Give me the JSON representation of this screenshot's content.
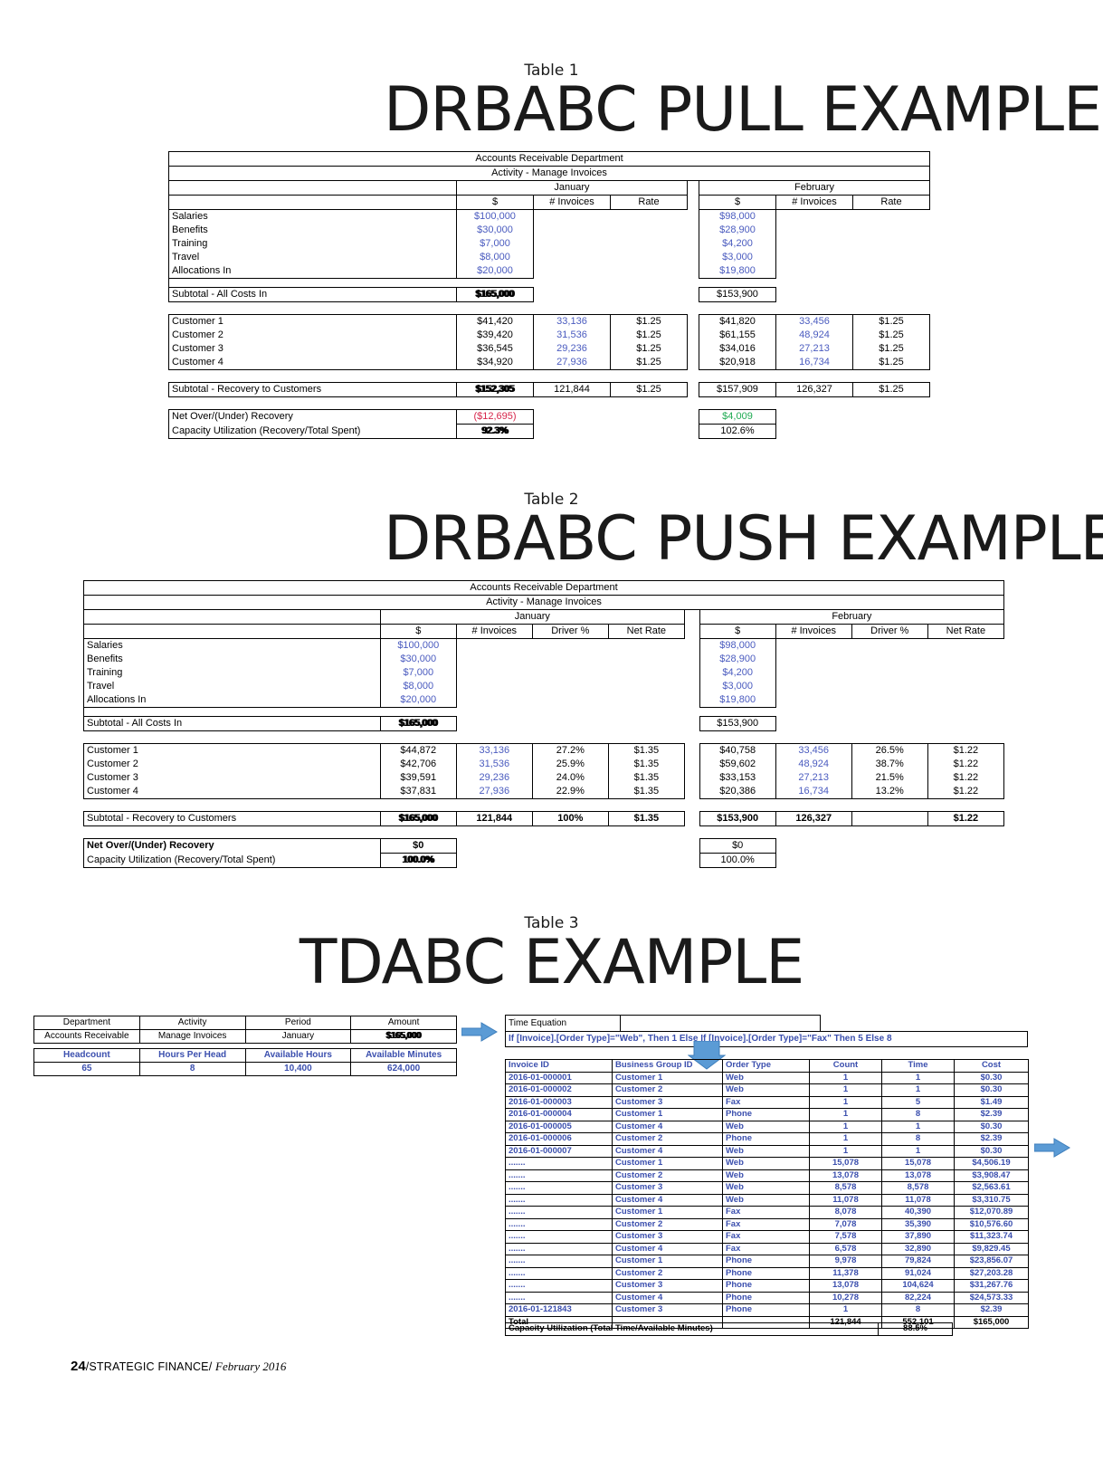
{
  "page": {
    "footer_page": "24",
    "footer_pub": "/STRATEGIC FINANCE/",
    "footer_issue": "February 2016"
  },
  "table1": {
    "caption": "Table 1",
    "title": "DRBABC PULL EXAMPLE",
    "dept": "Accounts Receivable Department",
    "activity": "Activity - Manage Invoices",
    "period_jan": "January",
    "period_feb": "February",
    "colheads": [
      "$",
      "# Invoices",
      "Rate"
    ],
    "cost_rows": [
      {
        "label": "Salaries",
        "jan_dollar": "$100,000",
        "feb_dollar": "$98,000"
      },
      {
        "label": "Benefits",
        "jan_dollar": "$30,000",
        "feb_dollar": "$28,900"
      },
      {
        "label": "Training",
        "jan_dollar": "$7,000",
        "feb_dollar": "$4,200"
      },
      {
        "label": "Travel",
        "jan_dollar": "$8,000",
        "feb_dollar": "$3,000"
      },
      {
        "label": "Allocations In",
        "jan_dollar": "$20,000",
        "feb_dollar": "$19,800"
      }
    ],
    "subtotal_costs": {
      "label": "Subtotal - All Costs In",
      "jan": "$165,000",
      "feb": "$153,900"
    },
    "customer_rows": [
      {
        "label": "Customer 1",
        "jan_dollar": "$41,420",
        "jan_inv": "33,136",
        "jan_rate": "$1.25",
        "feb_dollar": "$41,820",
        "feb_inv": "33,456",
        "feb_rate": "$1.25"
      },
      {
        "label": "Customer 2",
        "jan_dollar": "$39,420",
        "jan_inv": "31,536",
        "jan_rate": "$1.25",
        "feb_dollar": "$61,155",
        "feb_inv": "48,924",
        "feb_rate": "$1.25"
      },
      {
        "label": "Customer 3",
        "jan_dollar": "$36,545",
        "jan_inv": "29,236",
        "jan_rate": "$1.25",
        "feb_dollar": "$34,016",
        "feb_inv": "27,213",
        "feb_rate": "$1.25"
      },
      {
        "label": "Customer 4",
        "jan_dollar": "$34,920",
        "jan_inv": "27,936",
        "jan_rate": "$1.25",
        "feb_dollar": "$20,918",
        "feb_inv": "16,734",
        "feb_rate": "$1.25"
      }
    ],
    "subtotal_recovery": {
      "label": "Subtotal - Recovery to Customers",
      "jan_dollar": "$152,305",
      "jan_inv": "121,844",
      "jan_rate": "$1.25",
      "feb_dollar": "$157,909",
      "feb_inv": "126,327",
      "feb_rate": "$1.25"
    },
    "net_recovery": {
      "label": "Net Over/(Under) Recovery",
      "jan": "($12,695)",
      "feb": "$4,009"
    },
    "capacity": {
      "label": "Capacity Utilization (Recovery/Total Spent)",
      "jan": "92.3%",
      "feb": "102.6%"
    }
  },
  "table2": {
    "caption": "Table 2",
    "title": "DRBABC PUSH EXAMPLE",
    "dept": "Accounts Receivable Department",
    "activity": "Activity - Manage Invoices",
    "period_jan": "January",
    "period_feb": "February",
    "colheads": [
      "$",
      "# Invoices",
      "Driver %",
      "Net Rate"
    ],
    "cost_rows": [
      {
        "label": "Salaries",
        "jan_dollar": "$100,000",
        "feb_dollar": "$98,000"
      },
      {
        "label": "Benefits",
        "jan_dollar": "$30,000",
        "feb_dollar": "$28,900"
      },
      {
        "label": "Training",
        "jan_dollar": "$7,000",
        "feb_dollar": "$4,200"
      },
      {
        "label": "Travel",
        "jan_dollar": "$8,000",
        "feb_dollar": "$3,000"
      },
      {
        "label": "Allocations In",
        "jan_dollar": "$20,000",
        "feb_dollar": "$19,800"
      }
    ],
    "subtotal_costs": {
      "label": "Subtotal - All Costs In",
      "jan": "$165,000",
      "feb": "$153,900"
    },
    "customer_rows": [
      {
        "label": "Customer 1",
        "jan_dollar": "$44,872",
        "jan_inv": "33,136",
        "jan_driver": "27.2%",
        "jan_rate": "$1.35",
        "feb_dollar": "$40,758",
        "feb_inv": "33,456",
        "feb_driver": "26.5%",
        "feb_rate": "$1.22"
      },
      {
        "label": "Customer 2",
        "jan_dollar": "$42,706",
        "jan_inv": "31,536",
        "jan_driver": "25.9%",
        "jan_rate": "$1.35",
        "feb_dollar": "$59,602",
        "feb_inv": "48,924",
        "feb_driver": "38.7%",
        "feb_rate": "$1.22"
      },
      {
        "label": "Customer 3",
        "jan_dollar": "$39,591",
        "jan_inv": "29,236",
        "jan_driver": "24.0%",
        "jan_rate": "$1.35",
        "feb_dollar": "$33,153",
        "feb_inv": "27,213",
        "feb_driver": "21.5%",
        "feb_rate": "$1.22"
      },
      {
        "label": "Customer 4",
        "jan_dollar": "$37,831",
        "jan_inv": "27,936",
        "jan_driver": "22.9%",
        "jan_rate": "$1.35",
        "feb_dollar": "$20,386",
        "feb_inv": "16,734",
        "feb_driver": "13.2%",
        "feb_rate": "$1.22"
      }
    ],
    "subtotal_recovery": {
      "label": "Subtotal - Recovery to Customers",
      "jan_dollar": "$165,000",
      "jan_inv": "121,844",
      "jan_driver": "100%",
      "jan_rate": "$1.35",
      "feb_dollar": "$153,900",
      "feb_inv": "126,327",
      "feb_driver": "",
      "feb_rate": "$1.22"
    },
    "net_recovery": {
      "label": "Net Over/(Under) Recovery",
      "jan": "$0",
      "feb": "$0"
    },
    "capacity": {
      "label": "Capacity Utilization (Recovery/Total Spent)",
      "jan": "100.0%",
      "feb": "100.0%"
    }
  },
  "table3": {
    "caption": "Table 3",
    "title": "TDABC EXAMPLE",
    "dept_table": {
      "headers": [
        "Department",
        "Activity",
        "Period",
        "Amount"
      ],
      "values": [
        "Accounts Receivable",
        "Manage Invoices",
        "January",
        "$165,000"
      ]
    },
    "capacity_table": {
      "headers": [
        "Headcount",
        "Hours Per Head",
        "Available Hours",
        "Available Minutes"
      ],
      "values": [
        "65",
        "8",
        "10,400",
        "624,000"
      ]
    },
    "time_equation": {
      "header": "Time Equation",
      "formula": "If [Invoice].[Order Type]=\"Web\", Then 1 Else If [Invoice].[Order Type]=\"Fax\" Then 5 Else 8"
    },
    "detail": {
      "headers": [
        "Invoice ID",
        "Business Group ID",
        "Order Type",
        "Count",
        "Time",
        "Cost"
      ],
      "rows": [
        [
          "2016-01-000001",
          "Customer 1",
          "Web",
          "1",
          "1",
          "$0.30"
        ],
        [
          "2016-01-000002",
          "Customer 2",
          "Web",
          "1",
          "1",
          "$0.30"
        ],
        [
          "2016-01-000003",
          "Customer 3",
          "Fax",
          "1",
          "5",
          "$1.49"
        ],
        [
          "2016-01-000004",
          "Customer 1",
          "Phone",
          "1",
          "8",
          "$2.39"
        ],
        [
          "2016-01-000005",
          "Customer 4",
          "Web",
          "1",
          "1",
          "$0.30"
        ],
        [
          "2016-01-000006",
          "Customer 2",
          "Phone",
          "1",
          "8",
          "$2.39"
        ],
        [
          "2016-01-000007",
          "Customer 4",
          "Web",
          "1",
          "1",
          "$0.30"
        ],
        [
          ".......",
          "Customer 1",
          "Web",
          "15,078",
          "15,078",
          "$4,506.19"
        ],
        [
          ".......",
          "Customer 2",
          "Web",
          "13,078",
          "13,078",
          "$3,908.47"
        ],
        [
          ".......",
          "Customer 3",
          "Web",
          "8,578",
          "8,578",
          "$2,563.61"
        ],
        [
          ".......",
          "Customer 4",
          "Web",
          "11,078",
          "11,078",
          "$3,310.75"
        ],
        [
          ".......",
          "Customer 1",
          "Fax",
          "8,078",
          "40,390",
          "$12,070.89"
        ],
        [
          ".......",
          "Customer 2",
          "Fax",
          "7,078",
          "35,390",
          "$10,576.60"
        ],
        [
          ".......",
          "Customer 3",
          "Fax",
          "7,578",
          "37,890",
          "$11,323.74"
        ],
        [
          ".......",
          "Customer 4",
          "Fax",
          "6,578",
          "32,890",
          "$9,829.45"
        ],
        [
          ".......",
          "Customer 1",
          "Phone",
          "9,978",
          "79,824",
          "$23,856.07"
        ],
        [
          ".......",
          "Customer 2",
          "Phone",
          "11,378",
          "91,024",
          "$27,203.28"
        ],
        [
          ".......",
          "Customer 3",
          "Phone",
          "13,078",
          "104,624",
          "$31,267.76"
        ],
        [
          ".......",
          "Customer 4",
          "Phone",
          "10,278",
          "82,224",
          "$24,573.33"
        ],
        [
          "2016-01-121843",
          "Customer 3",
          "Phone",
          "1",
          "8",
          "$2.39"
        ]
      ],
      "total": [
        "Total",
        "",
        "",
        "121,844",
        "552,101",
        "$165,000"
      ]
    },
    "capacity_util": {
      "label": "Capacity Utilization (Total Time/Available Minutes)",
      "value": "88.5%"
    }
  },
  "colors": {
    "blue_text": "#4a5bbf",
    "detail_blue": "#3b4fae",
    "negative_red": "#d6254a",
    "positive_green": "#1faa52",
    "arrow_fill": "#5b9bd5"
  }
}
